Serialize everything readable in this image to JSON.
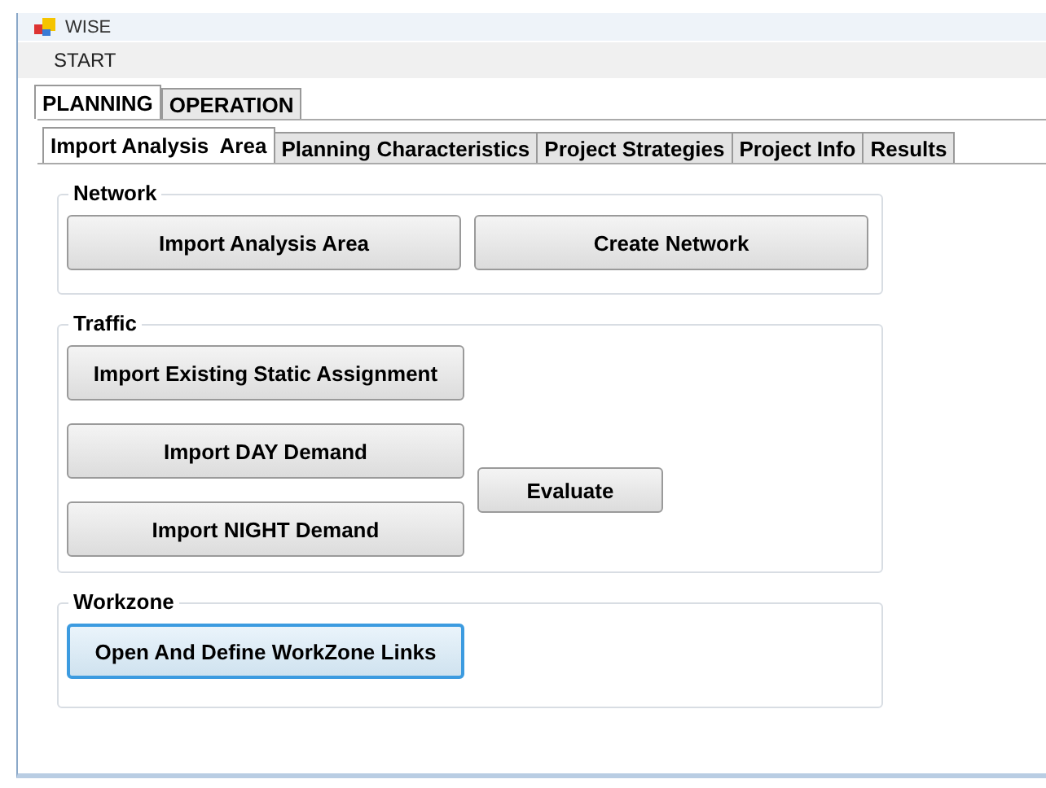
{
  "window": {
    "title": "WISE"
  },
  "menu": [
    "START"
  ],
  "outer_tabs": [
    {
      "label": "PLANNING",
      "selected": true
    },
    {
      "label": "OPERATION",
      "selected": false
    }
  ],
  "inner_tabs": [
    {
      "label": "Import Analysis  Area",
      "selected": true
    },
    {
      "label": "Planning Characteristics",
      "selected": false
    },
    {
      "label": "Project Strategies",
      "selected": false
    },
    {
      "label": "Project Info",
      "selected": false
    },
    {
      "label": "Results",
      "selected": false
    }
  ],
  "groups": [
    {
      "title": "Network",
      "kind": "row",
      "buttons": [
        {
          "label": "Import Analysis Area",
          "focused": false
        },
        {
          "label": "Create Network",
          "focused": false
        }
      ]
    },
    {
      "title": "Traffic",
      "kind": "stack",
      "buttons": [
        {
          "label": "Import Existing Static Assignment",
          "focused": false
        },
        {
          "label": "Import DAY Demand",
          "focused": false
        },
        {
          "label": "Import NIGHT Demand",
          "focused": false
        },
        {
          "label": "Evaluate",
          "focused": false
        }
      ]
    },
    {
      "title": "Workzone",
      "kind": "row",
      "buttons": [
        {
          "label": "Open And Define WorkZone Links",
          "focused": true
        }
      ]
    }
  ]
}
